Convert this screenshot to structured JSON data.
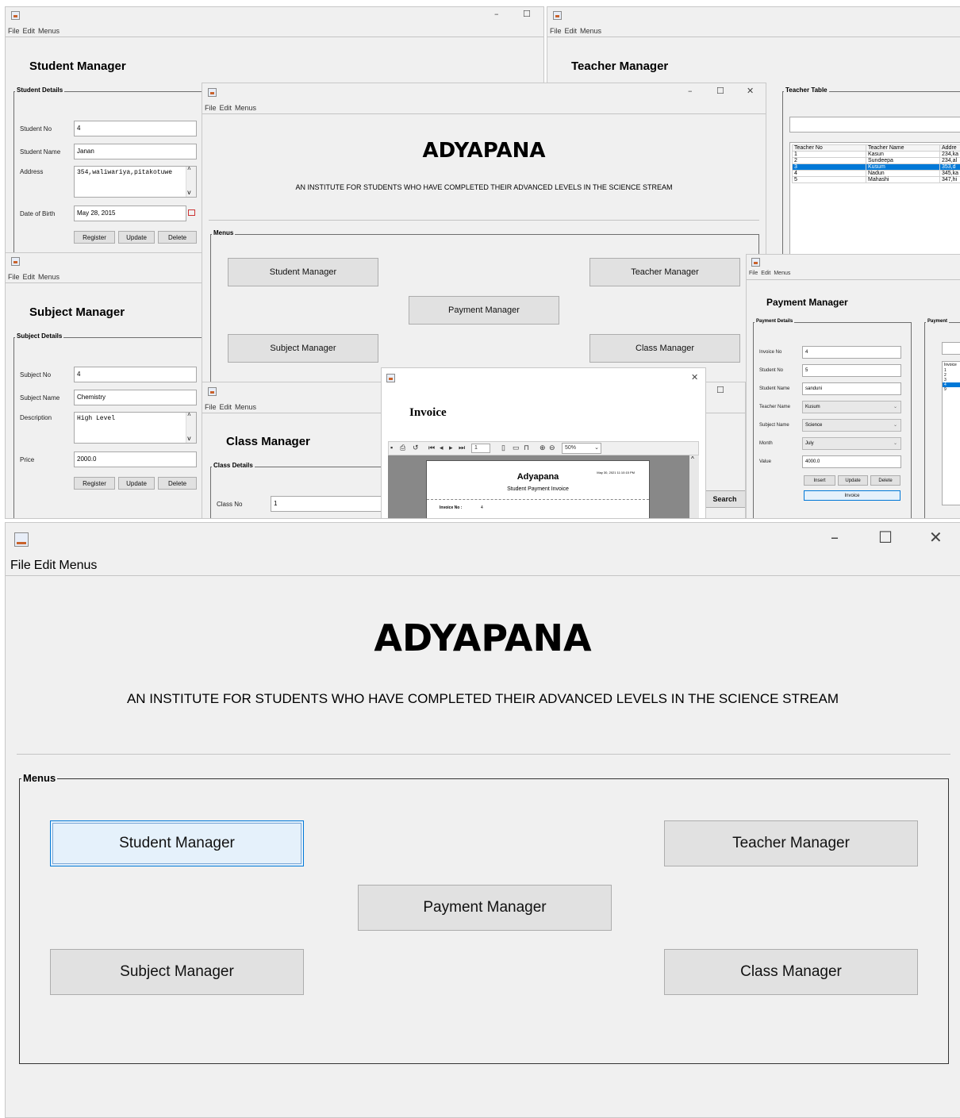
{
  "menus": [
    "File",
    "Edit",
    "Menus"
  ],
  "student_window": {
    "title": "Student Manager",
    "panel": "Student Details",
    "fields": [
      {
        "label": "Student No",
        "value": "4"
      },
      {
        "label": "Student Name",
        "value": "Janan"
      },
      {
        "label": "Address",
        "value": "354,waliwariya,pitakotuwe"
      },
      {
        "label": "Date of Birth",
        "value": "May 28, 2015"
      }
    ],
    "buttons": [
      "Register",
      "Update",
      "Delete"
    ]
  },
  "teacher_window": {
    "title": "Teacher Manager",
    "panel": "Teacher Table",
    "columns": [
      "Teacher No",
      "Teacher Name",
      "Addre"
    ],
    "rows": [
      [
        "1",
        "Kasun",
        "234,ka"
      ],
      [
        "2",
        "Sundeepa",
        "234,al"
      ],
      [
        "3",
        "Kusum",
        "353,d"
      ],
      [
        "4",
        "Nadun",
        "345,ka"
      ],
      [
        "5",
        "Mahashi",
        "347,hi"
      ]
    ],
    "selected_row": 2
  },
  "subject_window": {
    "title": "Subject Manager",
    "panel": "Subject Details",
    "fields": [
      {
        "label": "Subject No",
        "value": "4"
      },
      {
        "label": "Subject Name",
        "value": "Chemistry"
      },
      {
        "label": "Description",
        "value": "High Level"
      },
      {
        "label": "Price",
        "value": "2000.0"
      }
    ],
    "buttons": [
      "Register",
      "Update",
      "Delete"
    ]
  },
  "class_window": {
    "title": "Class Manager",
    "panel": "Class Details",
    "field_label": "Class No",
    "field_value": "1",
    "search": "Search"
  },
  "payment_window": {
    "title": "Payment Manager",
    "panel": "Payment Details",
    "panel2": "Payment",
    "fields": [
      {
        "label": "Invoice No",
        "value": "4"
      },
      {
        "label": "Student No",
        "value": "5"
      },
      {
        "label": "Student Name",
        "value": "sanduni"
      },
      {
        "label": "Teacher Name",
        "value": "Kusum"
      },
      {
        "label": "Subject Name",
        "value": "Science"
      },
      {
        "label": "Month",
        "value": "July"
      },
      {
        "label": "Value",
        "value": "4000.0"
      }
    ],
    "buttons": [
      "Insert",
      "Update",
      "Delete"
    ],
    "invoice_button": "Invoice",
    "side_header": "Invoice",
    "side_rows": [
      "1",
      "2",
      "3",
      "4",
      "9"
    ],
    "side_selected": 3
  },
  "invoice_window": {
    "title": "Invoice",
    "zoom": "50%",
    "page_field": "1",
    "report_title": "Adyapana",
    "report_date": "May 30, 2021 11:10:15 PM",
    "report_subtitle": "Student Payment Invoice",
    "report_line_label": "Invoice No :",
    "report_line_value": "4"
  },
  "main_small": {
    "heading": "ADYAPANA",
    "subheading": "AN INSTITUTE FOR STUDENTS WHO HAVE COMPLETED THEIR ADVANCED LEVELS IN THE SCIENCE STREAM",
    "panel": "Menus",
    "buttons": {
      "student": "Student Manager",
      "teacher": "Teacher Manager",
      "payment": "Payment Manager",
      "subject": "Subject Manager",
      "class": "Class Manager"
    }
  },
  "main": {
    "heading": "ADYAPANA",
    "subheading": "AN INSTITUTE FOR STUDENTS WHO HAVE COMPLETED THEIR ADVANCED LEVELS IN THE SCIENCE STREAM",
    "panel": "Menus",
    "buttons": {
      "student": "Student Manager",
      "teacher": "Teacher Manager",
      "payment": "Payment Manager",
      "subject": "Subject Manager",
      "class": "Class Manager"
    }
  }
}
